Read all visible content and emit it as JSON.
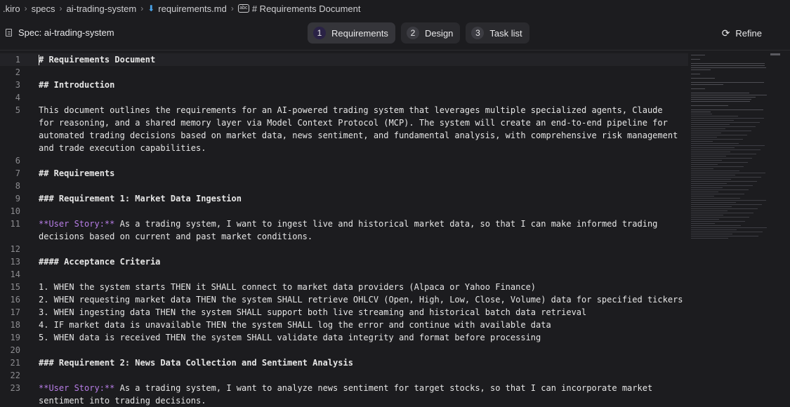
{
  "breadcrumb": {
    "items": [
      ".kiro",
      "specs",
      "ai-trading-system",
      "requirements.md",
      "# Requirements Document"
    ],
    "file_icon": "markdown-icon",
    "symbol_icon": "abc-symbol-icon"
  },
  "toolbar": {
    "spec_title": "Spec: ai-trading-system",
    "tabs": [
      {
        "num": "1",
        "label": "Requirements"
      },
      {
        "num": "2",
        "label": "Design"
      },
      {
        "num": "3",
        "label": "Task list"
      }
    ],
    "refine_label": "Refine"
  },
  "editor": {
    "lines": [
      {
        "n": "1",
        "text": "# Requirements Document"
      },
      {
        "n": "2",
        "text": ""
      },
      {
        "n": "3",
        "text": "## Introduction"
      },
      {
        "n": "4",
        "text": ""
      },
      {
        "n": "5",
        "text": "This document outlines the requirements for an AI-powered trading system that leverages multiple specialized agents, Claude"
      },
      {
        "n": "",
        "text": "for reasoning, and a shared memory layer via Model Context Protocol (MCP). The system will create an end-to-end pipeline for"
      },
      {
        "n": "",
        "text": "automated trading decisions based on market data, news sentiment, and fundamental analysis, with comprehensive risk management"
      },
      {
        "n": "",
        "text": "and trade execution capabilities."
      },
      {
        "n": "6",
        "text": ""
      },
      {
        "n": "7",
        "text": "## Requirements"
      },
      {
        "n": "8",
        "text": ""
      },
      {
        "n": "9",
        "text": "### Requirement 1: Market Data Ingestion"
      },
      {
        "n": "10",
        "text": ""
      },
      {
        "n": "11",
        "prefix": "**User Story:**",
        "text": " As a trading system, I want to ingest live and historical market data, so that I can make informed trading"
      },
      {
        "n": "",
        "text": "decisions based on current and past market conditions."
      },
      {
        "n": "12",
        "text": ""
      },
      {
        "n": "13",
        "text": "#### Acceptance Criteria"
      },
      {
        "n": "14",
        "text": ""
      },
      {
        "n": "15",
        "text": "1. WHEN the system starts THEN it SHALL connect to market data providers (Alpaca or Yahoo Finance)"
      },
      {
        "n": "16",
        "text": "2. WHEN requesting market data THEN the system SHALL retrieve OHLCV (Open, High, Low, Close, Volume) data for specified tickers"
      },
      {
        "n": "17",
        "text": "3. WHEN ingesting data THEN the system SHALL support both live streaming and historical batch data retrieval"
      },
      {
        "n": "18",
        "text": "4. IF market data is unavailable THEN the system SHALL log the error and continue with available data"
      },
      {
        "n": "19",
        "text": "5. WHEN data is received THEN the system SHALL validate data integrity and format before processing"
      },
      {
        "n": "20",
        "text": ""
      },
      {
        "n": "21",
        "text": "### Requirement 2: News Data Collection and Sentiment Analysis"
      },
      {
        "n": "22",
        "text": ""
      },
      {
        "n": "23",
        "prefix": "**User Story:**",
        "text": " As a trading system, I want to analyze news sentiment for target stocks, so that I can incorporate market"
      },
      {
        "n": "",
        "text": "sentiment into trading decisions."
      }
    ]
  }
}
